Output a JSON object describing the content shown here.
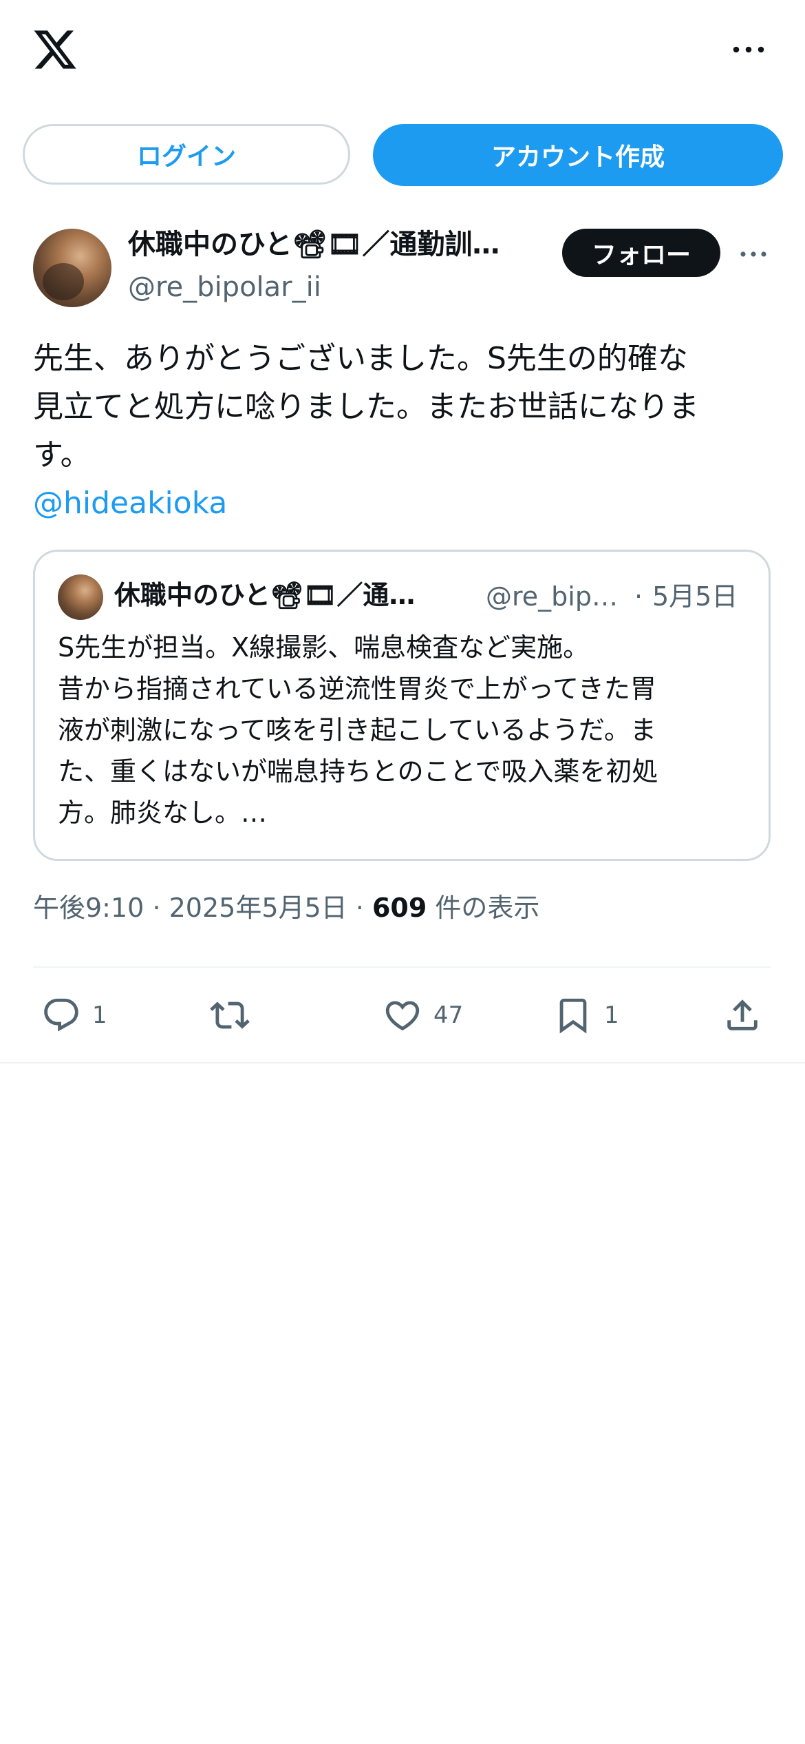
{
  "header": {
    "logo_icon": "x-logo-icon",
    "more_icon": "more-horizontal-icon"
  },
  "auth": {
    "login_label": "ログイン",
    "signup_label": "アカウント作成"
  },
  "tweet": {
    "author_name": "休職中のひと📽🎞／通勤訓…",
    "author_handle": "@re_bipolar_ii",
    "follow_label": "フォロー",
    "text": "先生、ありがとうございました。S先生の的確な\n見立てと処方に唸りました。またお世話になりま\nす。",
    "mention": "@hideakioka",
    "time": "午後9:10",
    "date": "2025年5月5日",
    "views_count": "609",
    "views_label": "件の表示",
    "separator": "·"
  },
  "quote": {
    "author_name": "休職中のひと📽🎞／通…",
    "author_handle": "@re_bip…",
    "separator": "·",
    "date": "5月5日",
    "text": "S先生が担当。X線撮影、喘息検査など実施。\n昔から指摘されている逆流性胃炎で上がってきた胃\n液が刺激になって咳を引き起こしているようだ。ま\nた、重くはないが喘息持ちとのことで吸入薬を初処\n方。肺炎なし。…"
  },
  "actions": {
    "reply_count": "1",
    "like_count": "47",
    "bookmark_count": "1"
  },
  "colors": {
    "accent": "#1d9bf0",
    "text": "#0f1419",
    "muted": "#536471",
    "border": "#cfd9de"
  }
}
